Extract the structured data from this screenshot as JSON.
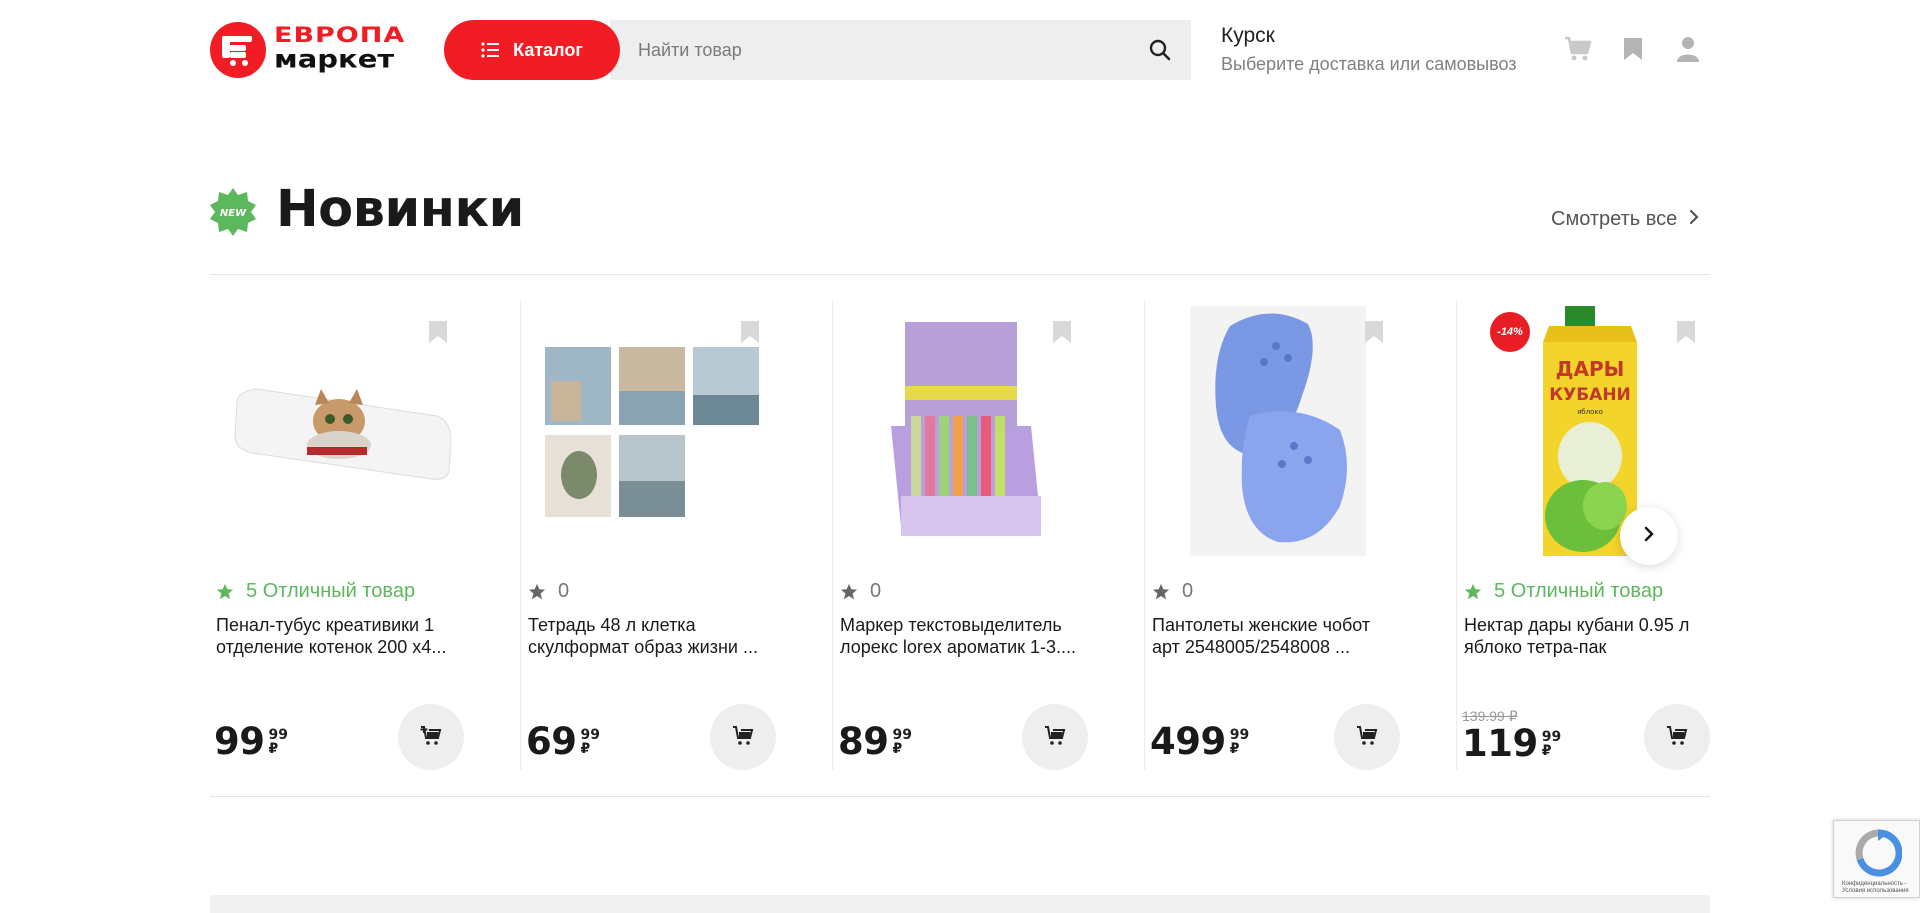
{
  "header": {
    "logo_top": "ЕВРОПА",
    "logo_bottom": "маркет",
    "catalog_label": "Каталог",
    "search_placeholder": "Найти товар",
    "city": "Курск",
    "delivery_hint": "Выберите доставка или самовывоз",
    "icons": [
      "cart-icon",
      "bookmark-icon",
      "user-icon"
    ]
  },
  "section": {
    "badge": "NEW",
    "title": "Новинки",
    "see_all": "Смотреть все"
  },
  "products": [
    {
      "title": "Пенал-тубус креативики 1 отделение котенок 200 x4...",
      "rating": "5",
      "rating_text": "Отличный товар",
      "price_main": "99",
      "price_kop": "99",
      "currency": "₽"
    },
    {
      "title": "Тетрадь 48 л клетка скулформат образ жизни ...",
      "rating": "0",
      "price_main": "69",
      "price_kop": "99",
      "currency": "₽"
    },
    {
      "title": "Маркер текстовыделитель лорекс lorex ароматик 1-3....",
      "rating": "0",
      "price_main": "89",
      "price_kop": "99",
      "currency": "₽"
    },
    {
      "title": "Пантолеты женские чобот арт 2548005/2548008 ...",
      "rating": "0",
      "price_main": "499",
      "price_kop": "99",
      "currency": "₽"
    },
    {
      "title": "Нектар дары кубани 0.95 л яблоко тетра-пак",
      "rating": "5",
      "rating_text": "Отличный товар",
      "discount": "-14%",
      "old_price": "139.99 ₽",
      "price_main": "119",
      "price_kop": "99",
      "currency": "₽",
      "pack_brand_1": "ДАРЫ",
      "pack_brand_2": "КУБАНИ",
      "pack_flavor": "яблоко"
    }
  ],
  "colors": {
    "brand_red": "#f21c24",
    "rating_green": "#5cb85c",
    "button_gray": "#eeeeee"
  },
  "recaptcha": {
    "text": "Конфиденциальность - Условия использования"
  }
}
